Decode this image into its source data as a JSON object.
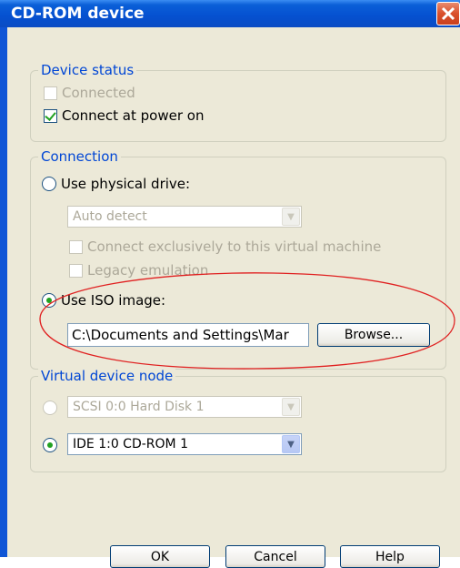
{
  "window": {
    "title": "CD-ROM device"
  },
  "device_status": {
    "legend": "Device status",
    "connected": {
      "label": "Connected",
      "checked": false,
      "enabled": false
    },
    "connect_at_power_on": {
      "label": "Connect at power on",
      "checked": true,
      "enabled": true
    }
  },
  "connection": {
    "legend": "Connection",
    "physical_drive": {
      "label": "Use physical drive:",
      "selected": false
    },
    "drive_select": {
      "value": "Auto detect",
      "enabled": false
    },
    "connect_exclusively": {
      "label": "Connect exclusively to this virtual machine",
      "enabled": false
    },
    "legacy_emulation": {
      "label": "Legacy emulation",
      "enabled": false
    },
    "iso_image": {
      "label": "Use ISO image:",
      "selected": true
    },
    "iso_path": "C:\\Documents and Settings\\Mar",
    "browse_label": "Browse..."
  },
  "virtual_device_node": {
    "legend": "Virtual device node",
    "scsi": {
      "value": "SCSI 0:0  Hard Disk 1",
      "selected": false,
      "enabled": false
    },
    "ide": {
      "value": "IDE 1:0  CD-ROM 1",
      "selected": true
    }
  },
  "buttons": {
    "ok": "OK",
    "cancel": "Cancel",
    "help": "Help"
  },
  "colors": {
    "title_bar": "#0550d0",
    "legend_text": "#0046d5",
    "highlight_ellipse": "#e02020",
    "check_green": "#21a121"
  }
}
